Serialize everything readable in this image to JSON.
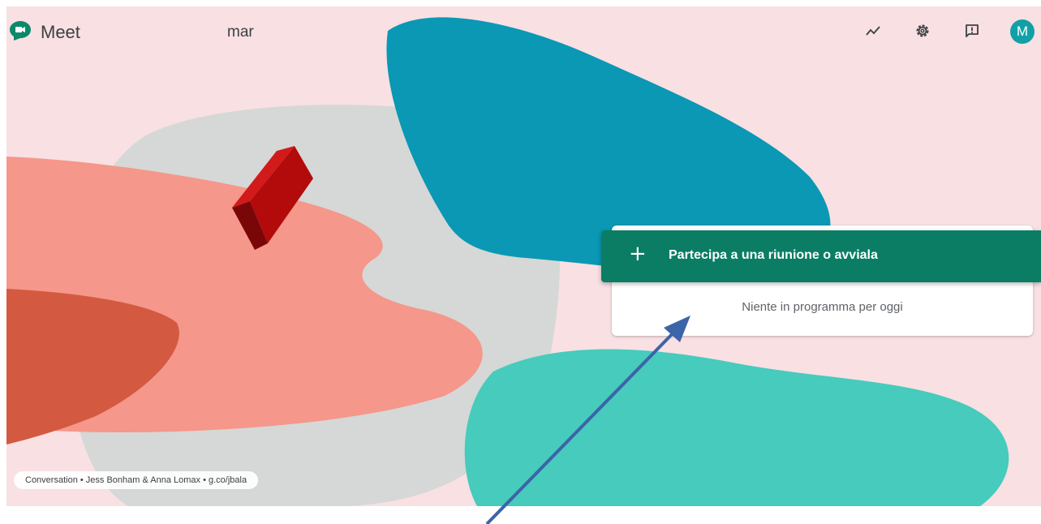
{
  "header": {
    "brand": "Meet",
    "time": "mar",
    "icons": [
      "quality-trend-icon",
      "settings-gear-icon",
      "feedback-icon"
    ],
    "avatar_initial": "M"
  },
  "main": {
    "join_button_icon": "+",
    "join_button_label": "Partecipa a una riunione o avviala",
    "empty_schedule": "Niente in programma per oggi"
  },
  "background_credit": "Conversation • Jess Bonham & Anna Lomax • g.co/jbala",
  "colors": {
    "accent_green": "#0b7d64",
    "avatar": "#12a0a7",
    "background": "#f8e0e3",
    "annotation_arrow": "#3c64a8"
  }
}
